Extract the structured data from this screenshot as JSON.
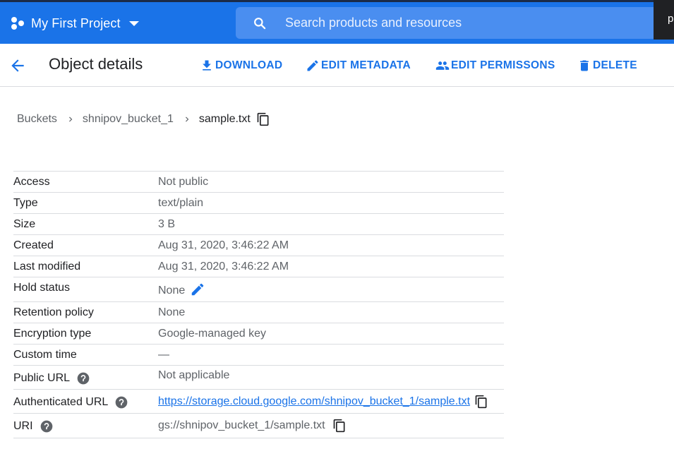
{
  "topbar": {
    "project_name": "My First Project",
    "search_placeholder": "Search products and resources",
    "corner_text": "p"
  },
  "actionbar": {
    "title": "Object details",
    "download": "DOWNLOAD",
    "edit_metadata": "EDIT METADATA",
    "edit_permissions": "EDIT PERMISSONS",
    "delete": "DELETE"
  },
  "breadcrumb": {
    "buckets": "Buckets",
    "bucket": "shnipov_bucket_1",
    "object": "sample.txt"
  },
  "details": {
    "access": {
      "key": "Access",
      "value": "Not public"
    },
    "type": {
      "key": "Type",
      "value": "text/plain"
    },
    "size": {
      "key": "Size",
      "value": "3 B"
    },
    "created": {
      "key": "Created",
      "value": "Aug 31, 2020, 3:46:22 AM"
    },
    "last_modified": {
      "key": "Last modified",
      "value": "Aug 31, 2020, 3:46:22 AM"
    },
    "hold_status": {
      "key": "Hold status",
      "value": "None"
    },
    "retention_policy": {
      "key": "Retention policy",
      "value": "None"
    },
    "encryption_type": {
      "key": "Encryption type",
      "value": "Google-managed key"
    },
    "custom_time": {
      "key": "Custom time",
      "value": "—"
    },
    "public_url": {
      "key": "Public URL",
      "value": "Not applicable"
    },
    "authenticated_url": {
      "key": "Authenticated URL",
      "value": "https://storage.cloud.google.com/shnipov_bucket_1/sample.txt"
    },
    "uri": {
      "key": "URI",
      "value": "gs://shnipov_bucket_1/sample.txt"
    }
  },
  "colors": {
    "brand_blue": "#1a73e8",
    "text_primary": "#202124",
    "text_secondary": "#5f6368",
    "divider": "#dadce0"
  }
}
